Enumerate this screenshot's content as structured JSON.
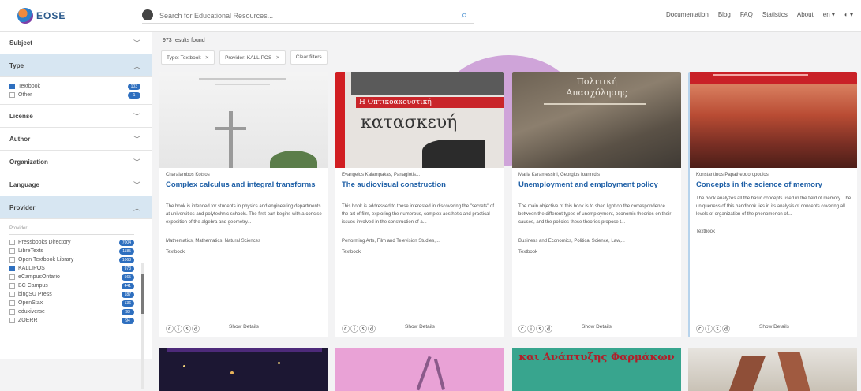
{
  "header": {
    "logo_text": "EOSE",
    "search_placeholder": "Search for Educational Resources...",
    "nav": [
      "Documentation",
      "Blog",
      "FAQ",
      "Statistics",
      "About",
      "en ▾",
      "◐ ▾"
    ]
  },
  "sidebar": {
    "subject": "Subject",
    "type": "Type",
    "type_options": [
      {
        "label": "Textbook",
        "count": "103",
        "checked": true
      },
      {
        "label": "Other",
        "count": "1",
        "checked": false
      }
    ],
    "license": "License",
    "author": "Author",
    "organization": "Organization",
    "language": "Language",
    "provider": "Provider",
    "provider_search_placeholder": "Provider",
    "provider_options": [
      {
        "label": "Pressbooks Directory",
        "count": "7004",
        "checked": false
      },
      {
        "label": "LibreTexts",
        "count": "1185",
        "checked": false
      },
      {
        "label": "Open Textbook Library",
        "count": "1068",
        "checked": false
      },
      {
        "label": "KALLIPOS",
        "count": "973",
        "checked": true
      },
      {
        "label": "eCampusOntario",
        "count": "565",
        "checked": false
      },
      {
        "label": "BC Campus",
        "count": "441",
        "checked": false
      },
      {
        "label": "bingSU Press",
        "count": "187",
        "checked": false
      },
      {
        "label": "OpenStax",
        "count": "136",
        "checked": false
      },
      {
        "label": "eduxiverse",
        "count": "93",
        "checked": false
      },
      {
        "label": "ZOERR",
        "count": "94",
        "checked": false
      }
    ]
  },
  "main": {
    "result_count": "973 results found",
    "chips": [
      "Type: Textbook",
      "Provider: KALLIPOS"
    ],
    "clear_filters": "Clear filters",
    "cards": [
      {
        "cover_text": "",
        "author": "Charalambos Kotsos",
        "title": "Complex calculus and integral transforms",
        "description": "The book is intended for students in physics and engineering departments at universities and polytechnic schools. The first part begins with a concise exposition of the algebra and geometry...",
        "subjects": "Mathematics, Mathematics, Natural Sciences",
        "type": "Textbook",
        "licenses": "ⓒⓘⓢⓓ",
        "details": "Show Details"
      },
      {
        "cover_text": "Η Οπτικοακουστική κατασκευή",
        "author": "Evangelos Kalampakas, Panagiotis...",
        "title": "The audiovisual construction",
        "description": "This book is addressed to those interested in discovering the \"secrets\" of the art of film, exploring the numerous, complex aesthetic and practical issues involved in the construction of a...",
        "subjects": "Performing Arts, Film and Television Studies,...",
        "type": "Textbook",
        "licenses": "ⓒⓘⓢⓓ",
        "details": "Show Details"
      },
      {
        "cover_text": "Πολιτική Απασχόλησης",
        "author": "Maria Karamessini, Georgios Ioannidis",
        "title": "Unemployment and employment policy",
        "description": "The main objective of this book is to shed light on the correspondence between the different types of unemployment, economic theories on their causes, and the policies these theories propose t...",
        "subjects": "Business and Economics, Political Science, Law,...",
        "type": "Textbook",
        "licenses": "ⓒⓘⓢⓓ",
        "details": "Show Details"
      },
      {
        "cover_text": "",
        "author": "Konstantinos Papatheodoropoulos",
        "title": "Concepts in the science of memory",
        "description": "The book analyzes all the basic concepts used in the field of memory. The uniqueness of this handbook lies in its analysis of concepts covering all levels of organization of the phenomenon of...",
        "subjects": "Textbook",
        "type": "",
        "licenses": "ⓒⓘⓢⓓ",
        "details": "Show Details"
      }
    ],
    "bottom_cover_3": "και Ανάπτυξης Φαρμάκων"
  }
}
